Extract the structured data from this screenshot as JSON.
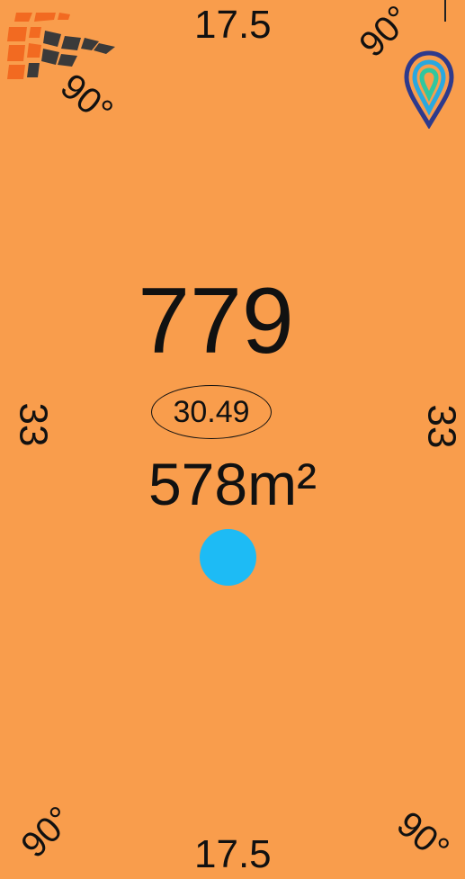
{
  "lot": {
    "number": "779",
    "area": "578m²",
    "oval_label": "30.49",
    "frontage_top": "17.5",
    "frontage_bottom": "17.5",
    "side_left": "33",
    "side_right": "33",
    "angle_top_left": "90°",
    "angle_top_right": "90°",
    "angle_bottom_left": "90°",
    "angle_bottom_right": "90°"
  },
  "colors": {
    "lot_fill": "#F99D4C",
    "marker_dot": "#1DBBF5",
    "text": "#111111"
  },
  "icons": [
    "building-blocks-logo-icon",
    "map-pin-logo-icon"
  ]
}
